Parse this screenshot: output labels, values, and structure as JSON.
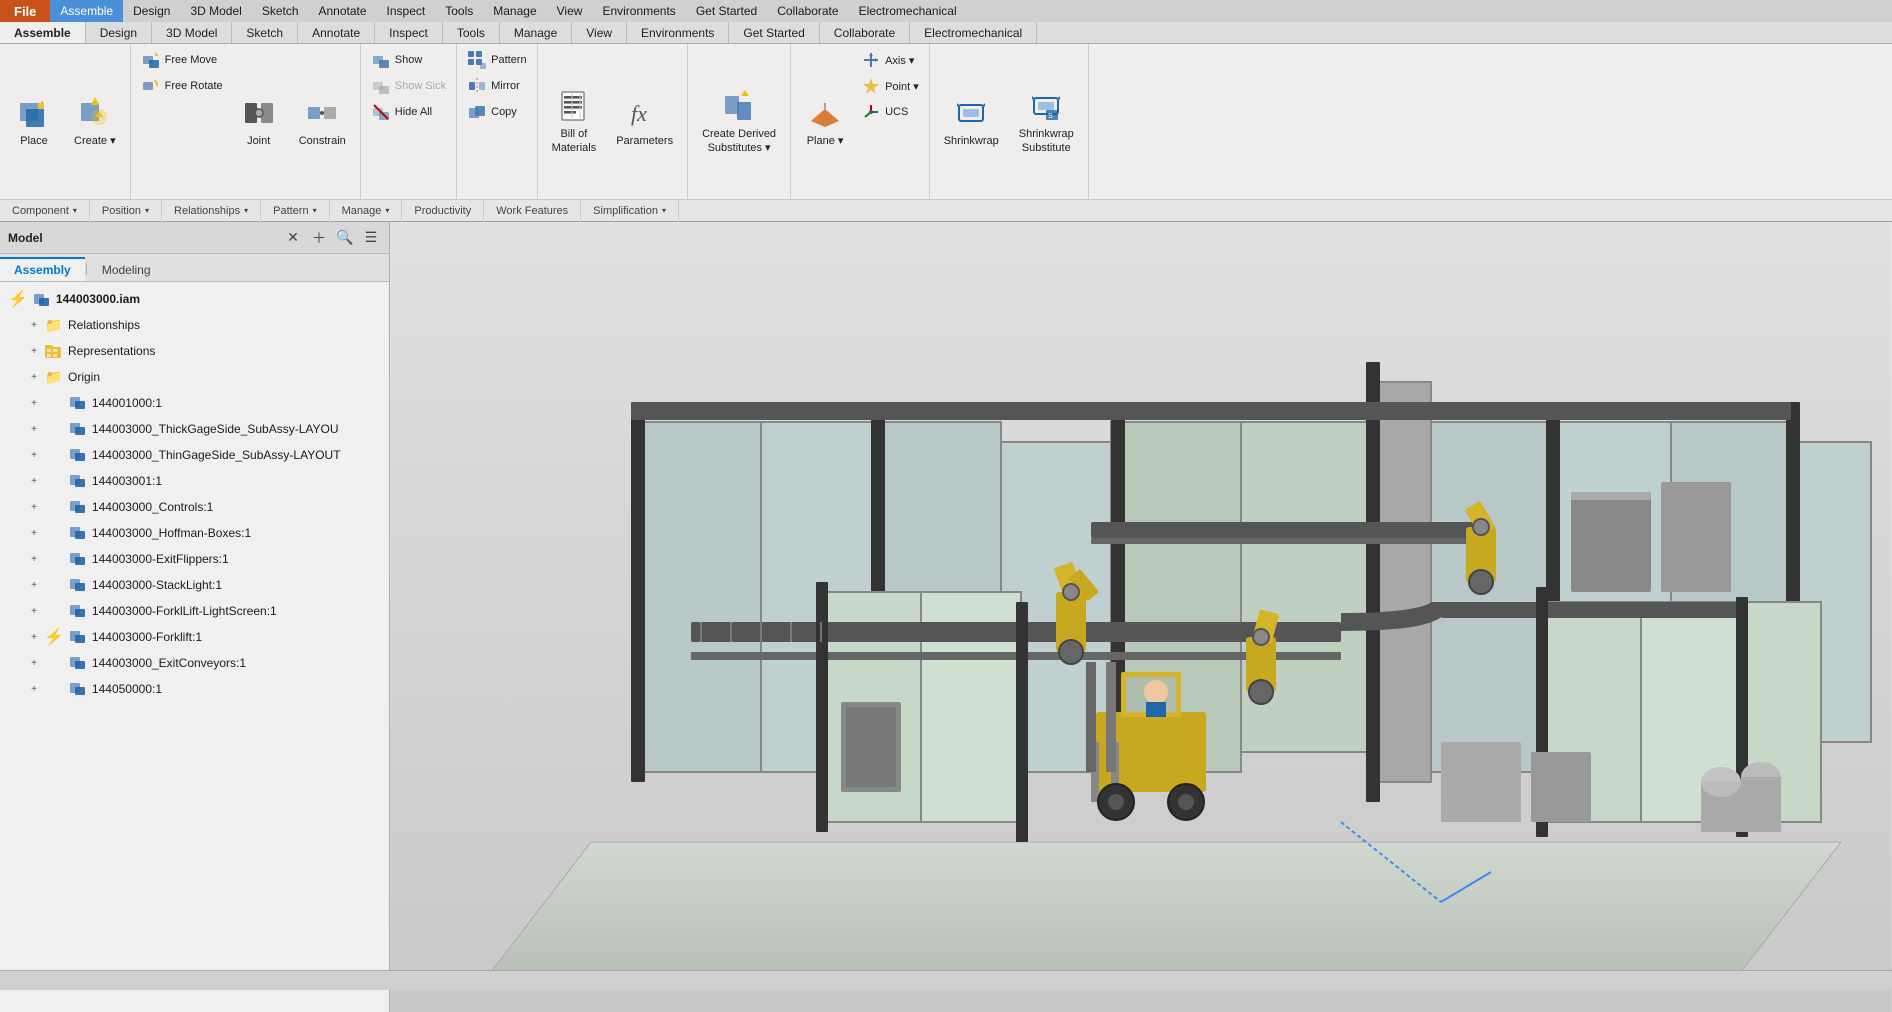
{
  "menu": {
    "file_label": "File",
    "tabs": [
      {
        "label": "Assemble",
        "active": true
      },
      {
        "label": "Design",
        "active": false
      },
      {
        "label": "3D Model",
        "active": false
      },
      {
        "label": "Sketch",
        "active": false
      },
      {
        "label": "Annotate",
        "active": false
      },
      {
        "label": "Inspect",
        "active": false
      },
      {
        "label": "Tools",
        "active": false
      },
      {
        "label": "Manage",
        "active": false
      },
      {
        "label": "View",
        "active": false
      },
      {
        "label": "Environments",
        "active": false
      },
      {
        "label": "Get Started",
        "active": false
      },
      {
        "label": "Collaborate",
        "active": false
      },
      {
        "label": "Electromechanical",
        "active": false
      }
    ]
  },
  "ribbon": {
    "groups": [
      {
        "name": "Component",
        "footer_label": "Component",
        "has_dropdown": true,
        "buttons": [
          {
            "id": "place",
            "label": "Place",
            "icon": "📦",
            "type": "large"
          },
          {
            "id": "create",
            "label": "Create",
            "icon": "⭐",
            "type": "large",
            "has_dropdown": true
          }
        ]
      },
      {
        "name": "Position",
        "footer_label": "Position",
        "has_dropdown": true,
        "buttons": [
          {
            "id": "free-move",
            "label": "Free Move",
            "icon": "↗",
            "type": "small"
          },
          {
            "id": "free-rotate",
            "label": "Free Rotate",
            "icon": "↻",
            "type": "small"
          },
          {
            "id": "joint",
            "label": "Joint",
            "icon": "🔗",
            "type": "large"
          },
          {
            "id": "constrain",
            "label": "Constrain",
            "icon": "🔒",
            "type": "large"
          }
        ]
      },
      {
        "name": "Relationships",
        "footer_label": "Relationships",
        "has_dropdown": true,
        "buttons": [
          {
            "id": "show",
            "label": "Show",
            "icon": "👁",
            "type": "small"
          },
          {
            "id": "show-sick",
            "label": "Show Sick",
            "icon": "👁",
            "type": "small",
            "disabled": true
          },
          {
            "id": "hide-all",
            "label": "Hide All",
            "icon": "🚫",
            "type": "small"
          }
        ]
      },
      {
        "name": "Pattern",
        "footer_label": "Pattern",
        "has_dropdown": true,
        "buttons": [
          {
            "id": "pattern",
            "label": "Pattern",
            "icon": "⊞",
            "type": "small"
          },
          {
            "id": "mirror",
            "label": "Mirror",
            "icon": "⇔",
            "type": "small"
          },
          {
            "id": "copy",
            "label": "Copy",
            "icon": "⧉",
            "type": "small"
          }
        ]
      },
      {
        "name": "Manage",
        "footer_label": "Manage",
        "has_dropdown": true,
        "buttons": [
          {
            "id": "bill-of-materials",
            "label": "Bill of\nMaterials",
            "icon": "📋",
            "type": "large"
          },
          {
            "id": "parameters",
            "label": "Parameters",
            "icon": "fx",
            "type": "large"
          }
        ]
      },
      {
        "name": "Productivity",
        "footer_label": "Productivity",
        "has_dropdown": false,
        "buttons": [
          {
            "id": "create-derived",
            "label": "Create Derived\nSubstitutes",
            "icon": "⭐",
            "type": "large",
            "has_dropdown": true
          }
        ]
      },
      {
        "name": "Work Features",
        "footer_label": "Work Features",
        "has_dropdown": false,
        "buttons": [
          {
            "id": "plane",
            "label": "Plane",
            "icon": "▱",
            "type": "large",
            "has_dropdown": true
          },
          {
            "id": "axis",
            "label": "Axis",
            "icon": "—",
            "type": "small",
            "has_dropdown": true
          },
          {
            "id": "point",
            "label": "Point",
            "icon": "◆",
            "type": "small",
            "has_dropdown": true
          },
          {
            "id": "ucs",
            "label": "UCS",
            "icon": "⊕",
            "type": "small"
          }
        ]
      },
      {
        "name": "Simplification",
        "footer_label": "Simplification",
        "has_dropdown": true,
        "buttons": [
          {
            "id": "shrinkwrap",
            "label": "Shrinkwrap",
            "icon": "🔷",
            "type": "large"
          },
          {
            "id": "shrinkwrap-sub",
            "label": "Shrinkwrap\nSubstitute",
            "icon": "🔷",
            "type": "large"
          }
        ]
      }
    ]
  },
  "left_panel": {
    "title": "Model",
    "tabs": [
      {
        "label": "Assembly",
        "active": true
      },
      {
        "label": "Modeling",
        "active": false
      }
    ],
    "tree": [
      {
        "id": "root",
        "label": "144003000.iam",
        "level": 0,
        "bold": true,
        "icon": "component",
        "has_lightning": true,
        "expanded": true
      },
      {
        "id": "relationships",
        "label": "Relationships",
        "level": 1,
        "icon": "folder-yellow",
        "has_lightning": false
      },
      {
        "id": "representations",
        "label": "Representations",
        "level": 1,
        "icon": "folder-yellow-grid",
        "has_lightning": false
      },
      {
        "id": "origin",
        "label": "Origin",
        "level": 1,
        "icon": "folder-yellow",
        "has_lightning": false
      },
      {
        "id": "item1",
        "label": "144001000:1",
        "level": 1,
        "icon": "component",
        "has_lightning": false
      },
      {
        "id": "item2",
        "label": "144003000_ThickGageSide_SubAssy-LAYOU",
        "level": 1,
        "icon": "component",
        "has_lightning": false
      },
      {
        "id": "item3",
        "label": "144003000_ThinGageSide_SubAssy-LAYOUT",
        "level": 1,
        "icon": "component",
        "has_lightning": false
      },
      {
        "id": "item4",
        "label": "144003001:1",
        "level": 1,
        "icon": "component",
        "has_lightning": false
      },
      {
        "id": "item5",
        "label": "144003000_Controls:1",
        "level": 1,
        "icon": "component",
        "has_lightning": false
      },
      {
        "id": "item6",
        "label": "144003000_Hoffman-Boxes:1",
        "level": 1,
        "icon": "component",
        "has_lightning": false
      },
      {
        "id": "item7",
        "label": "144003000-ExitFlippers:1",
        "level": 1,
        "icon": "component",
        "has_lightning": false
      },
      {
        "id": "item8",
        "label": "144003000-StackLight:1",
        "level": 1,
        "icon": "component",
        "has_lightning": false
      },
      {
        "id": "item9",
        "label": "144003000-ForklLift-LightScreen:1",
        "level": 1,
        "icon": "component",
        "has_lightning": false
      },
      {
        "id": "item10",
        "label": "144003000-Forklift:1",
        "level": 1,
        "icon": "component",
        "has_lightning": true
      },
      {
        "id": "item11",
        "label": "144003000_ExitConveyors:1",
        "level": 1,
        "icon": "component",
        "has_lightning": false
      },
      {
        "id": "item12",
        "label": "144050000:1",
        "level": 1,
        "icon": "component",
        "has_lightning": false
      }
    ]
  },
  "viewport": {
    "description": "3D Assembly view of industrial manufacturing cell"
  },
  "status_bar": {
    "text": ""
  }
}
